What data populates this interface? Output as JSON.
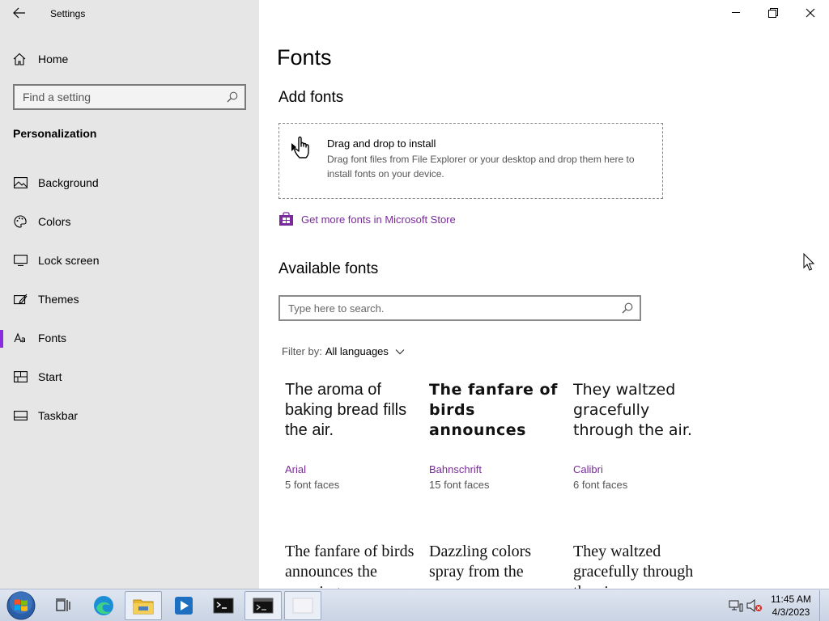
{
  "window": {
    "title": "Settings"
  },
  "sidebar": {
    "home_label": "Home",
    "search_placeholder": "Find a setting",
    "section_title": "Personalization",
    "items": [
      {
        "label": "Background",
        "icon": "picture-icon"
      },
      {
        "label": "Colors",
        "icon": "palette-icon"
      },
      {
        "label": "Lock screen",
        "icon": "monitor-icon"
      },
      {
        "label": "Themes",
        "icon": "brush-icon"
      },
      {
        "label": "Fonts",
        "icon": "font-icon",
        "active": true
      },
      {
        "label": "Start",
        "icon": "tiles-icon"
      },
      {
        "label": "Taskbar",
        "icon": "taskbar-icon"
      }
    ]
  },
  "main": {
    "title": "Fonts",
    "add_fonts_heading": "Add fonts",
    "dropzone": {
      "title": "Drag and drop to install",
      "description": "Drag font files from File Explorer or your desktop and drop them here to install fonts on your device."
    },
    "store_link": "Get more fonts in Microsoft Store",
    "available_heading": "Available fonts",
    "font_search_placeholder": "Type here to search.",
    "filter_label": "Filter by:",
    "filter_value": "All languages",
    "fonts": [
      {
        "sample": "The aroma of baking bread fills the air.",
        "name": "Arial",
        "faces": "5 font faces"
      },
      {
        "sample": "The fanfare of birds announces the…",
        "name": "Bahnschrift",
        "faces": "15 font faces"
      },
      {
        "sample": "They waltzed gracefully through the air.",
        "name": "Calibri",
        "faces": "6 font faces"
      },
      {
        "sample": "The fanfare of birds announces the morning.",
        "name": "",
        "faces": ""
      },
      {
        "sample": "Dazzling colors spray from the",
        "name": "",
        "faces": ""
      },
      {
        "sample": "They waltzed gracefully through the air.",
        "name": "",
        "faces": ""
      }
    ]
  },
  "taskbar": {
    "time": "11:45 AM",
    "date": "4/3/2023"
  },
  "colors": {
    "accent": "#8a2be2",
    "link": "#7a2a9a",
    "sidebar_bg": "#e6e6e6"
  }
}
